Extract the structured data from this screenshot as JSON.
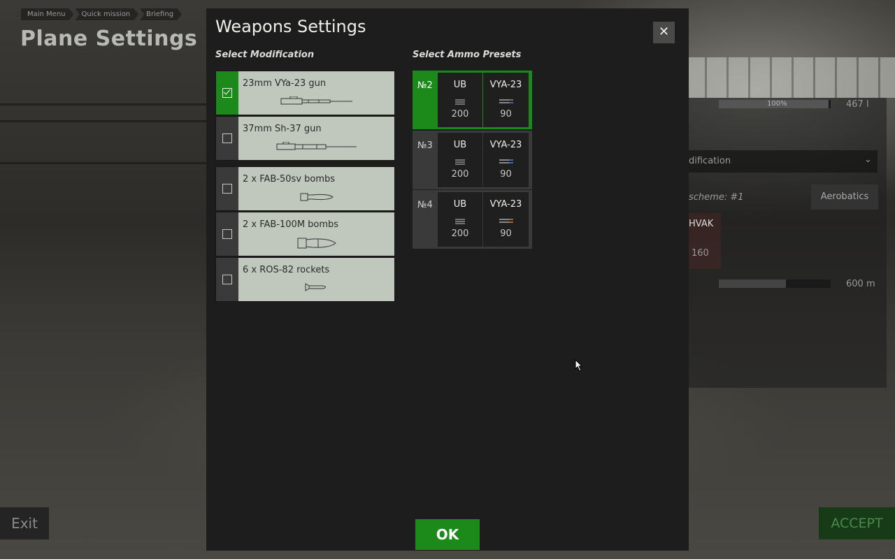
{
  "breadcrumb": [
    "Main Menu",
    "Quick mission",
    "Briefing"
  ],
  "page_title": "Plane Settings",
  "background_panel": {
    "fuel_percent_label": "100%",
    "fuel_value": "467 l",
    "modification_dropdown": "dification",
    "scheme_label": "scheme: #1",
    "aerobatics_label": "Aerobatics",
    "hvak_name": "HVAK",
    "hvak_count": "160",
    "range_value": "600 m",
    "range_level": 0.6
  },
  "exit_label": "Exit",
  "accept_label": "ACCEPT",
  "modal": {
    "title": "Weapons Settings",
    "close_glyph": "✕",
    "select_modification_label": "Select Modification",
    "select_ammo_label": "Select Ammo Presets",
    "modifications": [
      {
        "name": "23mm VYa-23 gun",
        "icon": "cannon-icon",
        "selected": true
      },
      {
        "name": "37mm Sh-37 gun",
        "icon": "cannon-icon",
        "selected": false
      },
      {
        "name": "2 x FAB-50sv bombs",
        "icon": "bomb-icon",
        "selected": false
      },
      {
        "name": "2 x FAB-100M bombs",
        "icon": "bomb-icon",
        "selected": false
      },
      {
        "name": "6 x ROS-82 rockets",
        "icon": "rocket-icon",
        "selected": false
      }
    ],
    "ammo_presets": [
      {
        "num": "№2",
        "selected": true,
        "slots": [
          {
            "name": "UB",
            "count": "200"
          },
          {
            "name": "VYA-23",
            "count": "90"
          }
        ]
      },
      {
        "num": "№3",
        "selected": false,
        "slots": [
          {
            "name": "UB",
            "count": "200"
          },
          {
            "name": "VYA-23",
            "count": "90"
          }
        ]
      },
      {
        "num": "№4",
        "selected": false,
        "slots": [
          {
            "name": "UB",
            "count": "200"
          },
          {
            "name": "VYA-23",
            "count": "90"
          }
        ]
      }
    ],
    "ok_label": "OK"
  },
  "colors": {
    "accent_green": "#1b8a1b",
    "modal_bg": "#1d1d1d",
    "mod_item_bg": "#c0c7bd"
  }
}
